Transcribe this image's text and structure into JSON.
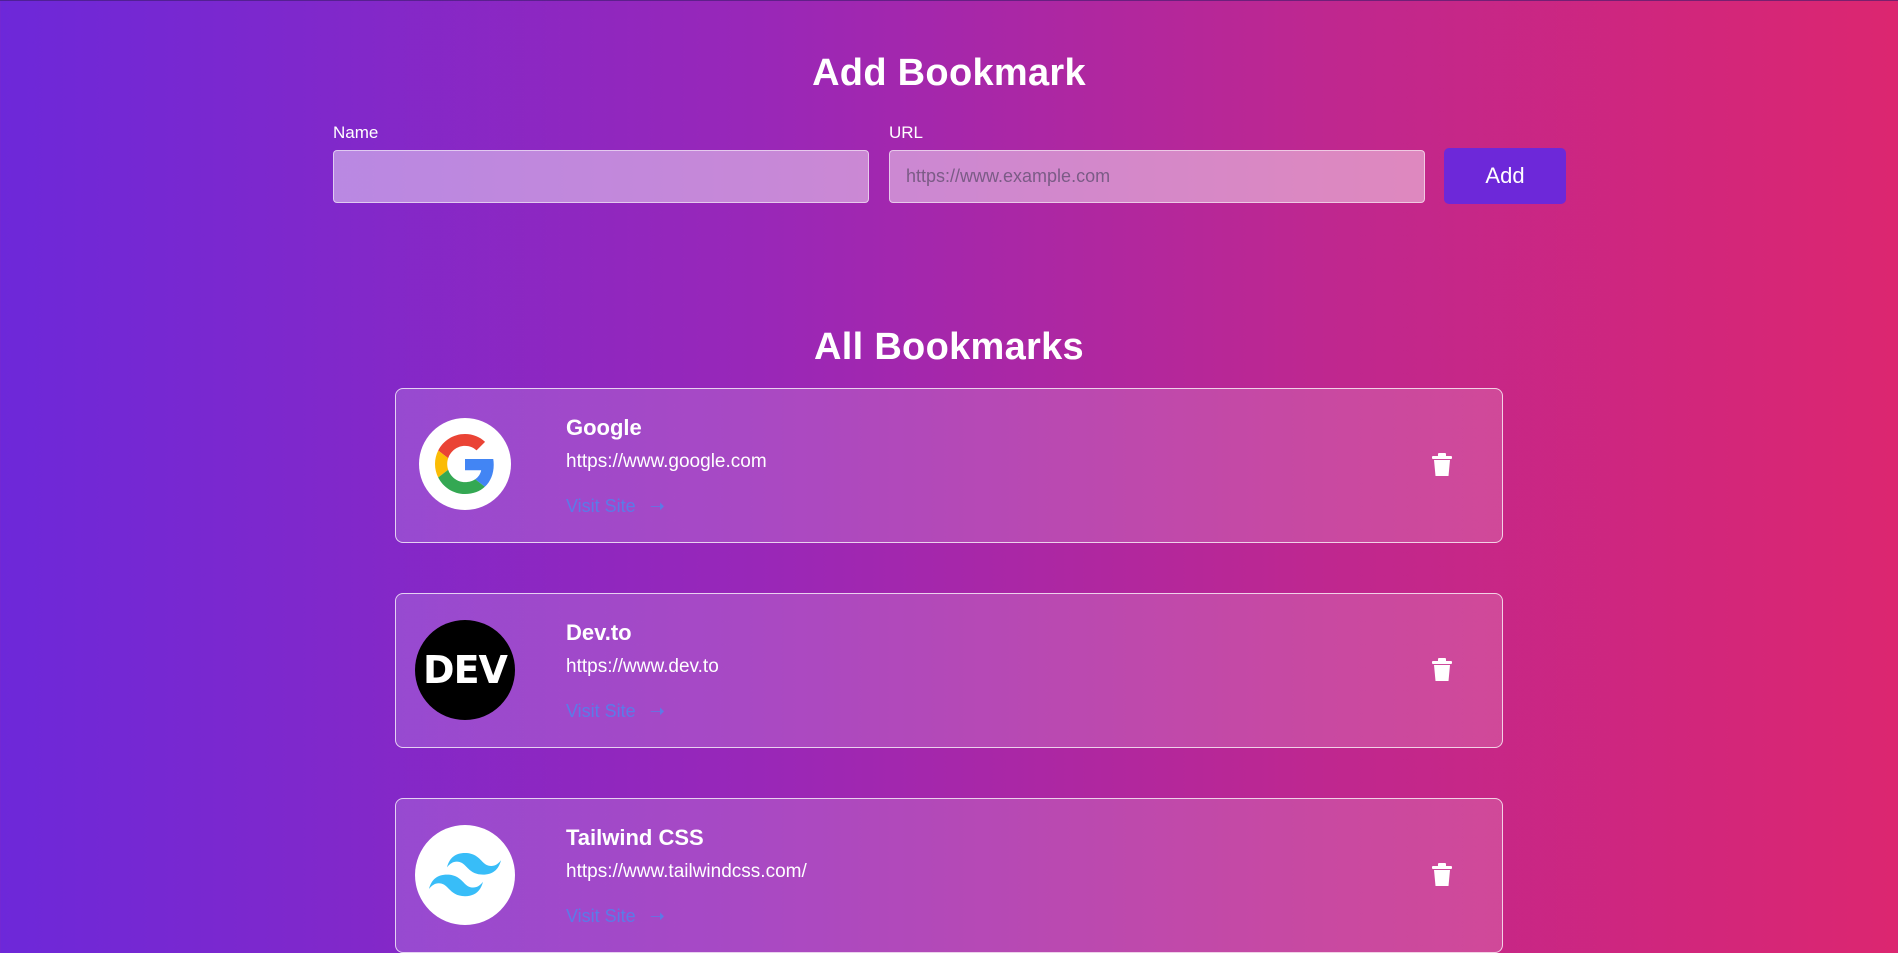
{
  "add_section": {
    "title": "Add Bookmark",
    "name_label": "Name",
    "name_value": "",
    "name_placeholder": "",
    "url_label": "URL",
    "url_value": "",
    "url_placeholder": "https://www.example.com",
    "add_label": "Add"
  },
  "list_section": {
    "title": "All Bookmarks",
    "visit_label": "Visit Site",
    "bookmarks": [
      {
        "name": "Google",
        "url": "https://www.google.com",
        "logo": "google-logo"
      },
      {
        "name": "Dev.to",
        "url": "https://www.dev.to",
        "logo": "dev-logo",
        "logo_text": "DEV"
      },
      {
        "name": "Tailwind CSS",
        "url": "https://www.tailwindcss.com/",
        "logo": "tailwind-logo"
      }
    ]
  },
  "colors": {
    "accent": "#6d28d9",
    "gradient_start": "#6d28d9",
    "gradient_end": "#dc2670",
    "visit_link": "#5b7be8"
  },
  "icons": {
    "delete": "trash-icon",
    "visit": "arrow-right-icon"
  }
}
